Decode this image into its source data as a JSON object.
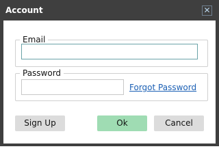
{
  "window": {
    "title": "Account",
    "close_glyph": "✕"
  },
  "form": {
    "email": {
      "legend": "Email",
      "value": "",
      "placeholder": ""
    },
    "password": {
      "legend": "Password",
      "value": "",
      "placeholder": ""
    },
    "forgot_link": "Forgot Password"
  },
  "buttons": {
    "signup": "Sign Up",
    "ok": "Ok",
    "cancel": "Cancel"
  },
  "colors": {
    "titlebar": "#3f3f3f",
    "ok_button": "#9fdcb3",
    "secondary_button": "#dcdcdc",
    "link": "#1a5fb4",
    "email_focus_border": "#6aa3a8"
  }
}
